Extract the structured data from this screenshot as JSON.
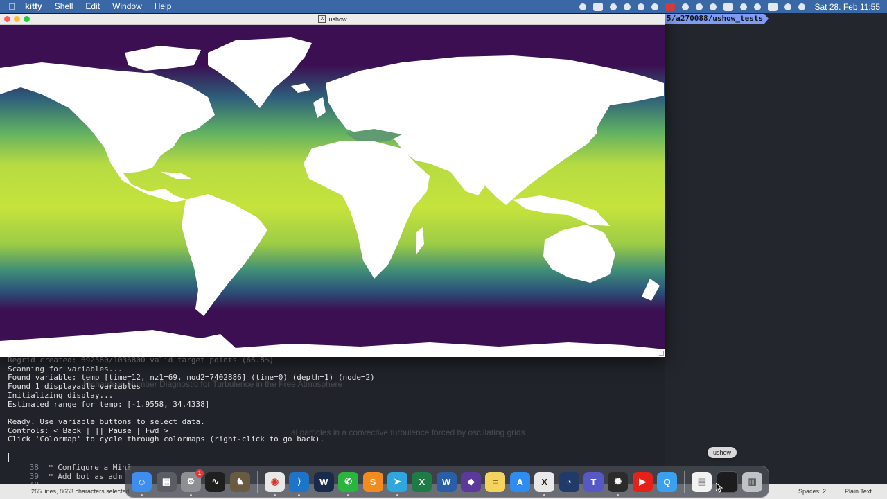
{
  "menubar": {
    "app": "kitty",
    "items": [
      "Shell",
      "Edit",
      "Window",
      "Help"
    ],
    "datetime": "Sat 28. Feb  11:55",
    "status_icons": [
      "record-icon",
      "keyboard-icon",
      "cloud-icon",
      "leaf-icon",
      "network-icon",
      "stack-icon",
      "battery-red-icon",
      "display-icon",
      "sound-icon",
      "clock-icon",
      "media-icon",
      "timemachine-icon",
      "wifi-icon",
      "input-source-icon",
      "search-icon",
      "control-center-icon"
    ]
  },
  "terminal": {
    "prompt_path": "5/a270088/ushow_tests",
    "lines_faded": "Regrid created: 692580/1036800 valid target points (66.8%)",
    "lines": [
      "Scanning for variables...",
      "Found variable: temp [time=12, nz1=69, nod2=7402886] (time=0) (depth=1) (node=2)",
      "Found 1 displayable variables",
      "Initializing display...",
      "Estimated range for temp: [-1.9558, 34.4338]",
      "",
      "Ready. Use variable buttons to select data.",
      "Controls: < Back | || Pause | Fwd >",
      "Click 'Colormap' to cycle through colormaps (right-click to go back)."
    ],
    "background_doc": {
      "heading": "Richardson Number Diagnostic for Turbulence in the Free Atmosphere",
      "subheading": "al particles in a convective turbulence forced by oscillating grids"
    },
    "editor": {
      "line38_num": "38",
      "line38": "* Configure a Mini",
      "line39_num": "39",
      "line39": "* Add bot as adm",
      "line40_num": "40"
    }
  },
  "statusbar": {
    "left": "265 lines, 8653 characters selected",
    "spaces": "Spaces: 2",
    "mode": "Plain Text"
  },
  "ushow_window": {
    "title": "ushow",
    "x11_glyph": "X",
    "colormap": {
      "low": "#3b0f52",
      "mid": "#2f8e82",
      "high": "#c6e33c"
    }
  },
  "dock": {
    "tooltip": "ushow",
    "badge": "1",
    "apps": [
      {
        "name": "finder-icon",
        "color": "#3d8ef0",
        "glyph": "☺",
        "dot": true
      },
      {
        "name": "calculator-icon",
        "color": "#5a5d63",
        "glyph": "▦",
        "dot": false
      },
      {
        "name": "system-settings-icon",
        "color": "#8e8f93",
        "glyph": "⚙",
        "dot": true,
        "badge": true
      },
      {
        "name": "activity-monitor-icon",
        "color": "#1f1f1f",
        "glyph": "∿",
        "dot": false
      },
      {
        "name": "gimp-icon",
        "color": "#6b5a42",
        "glyph": "♞",
        "dot": false
      },
      {
        "name": "chrome-icon",
        "color": "#e8e8e8",
        "glyph": "◉",
        "dot": true
      },
      {
        "name": "vscode-icon",
        "color": "#1e74c9",
        "glyph": "⟩",
        "dot": true
      },
      {
        "name": "webex-icon",
        "color": "#1a2a4a",
        "glyph": "W",
        "dot": false
      },
      {
        "name": "whatsapp-icon",
        "color": "#2ab540",
        "glyph": "✆",
        "dot": true
      },
      {
        "name": "sublime-icon",
        "color": "#f48b1f",
        "glyph": "S",
        "dot": false
      },
      {
        "name": "telegram-icon",
        "color": "#2ea6de",
        "glyph": "➤",
        "dot": true
      },
      {
        "name": "excel-icon",
        "color": "#1e7b45",
        "glyph": "X",
        "dot": false
      },
      {
        "name": "word-icon",
        "color": "#2b5ea8",
        "glyph": "W",
        "dot": false
      },
      {
        "name": "obsidian-icon",
        "color": "#5b3a9c",
        "glyph": "◆",
        "dot": false
      },
      {
        "name": "notes-icon",
        "color": "#f4d35e",
        "glyph": "≡",
        "dot": false
      },
      {
        "name": "app-store-icon",
        "color": "#2f8cf0",
        "glyph": "A",
        "dot": false
      },
      {
        "name": "x11-icon",
        "color": "#e9e9e9",
        "glyph": "X",
        "dot": true
      },
      {
        "name": "clock-app-icon",
        "color": "#203a6a",
        "glyph": "◔",
        "dot": false
      },
      {
        "name": "teams-icon",
        "color": "#5558c5",
        "glyph": "T",
        "dot": false
      },
      {
        "name": "chatgpt-icon",
        "color": "#2b2b2b",
        "glyph": "✺",
        "dot": true
      },
      {
        "name": "youtube-icon",
        "color": "#e62117",
        "glyph": "▶",
        "dot": false
      },
      {
        "name": "quicktime-icon",
        "color": "#3aa0f0",
        "glyph": "Q",
        "dot": false
      }
    ],
    "right_items": [
      {
        "name": "document-icon",
        "color": "#f2f2f2",
        "glyph": "▤"
      },
      {
        "name": "ushow-window-thumbnail-icon",
        "color": "#1c1c1c",
        "glyph": ""
      },
      {
        "name": "trash-icon",
        "color": "#bfc3c8",
        "glyph": "🗑"
      }
    ]
  }
}
